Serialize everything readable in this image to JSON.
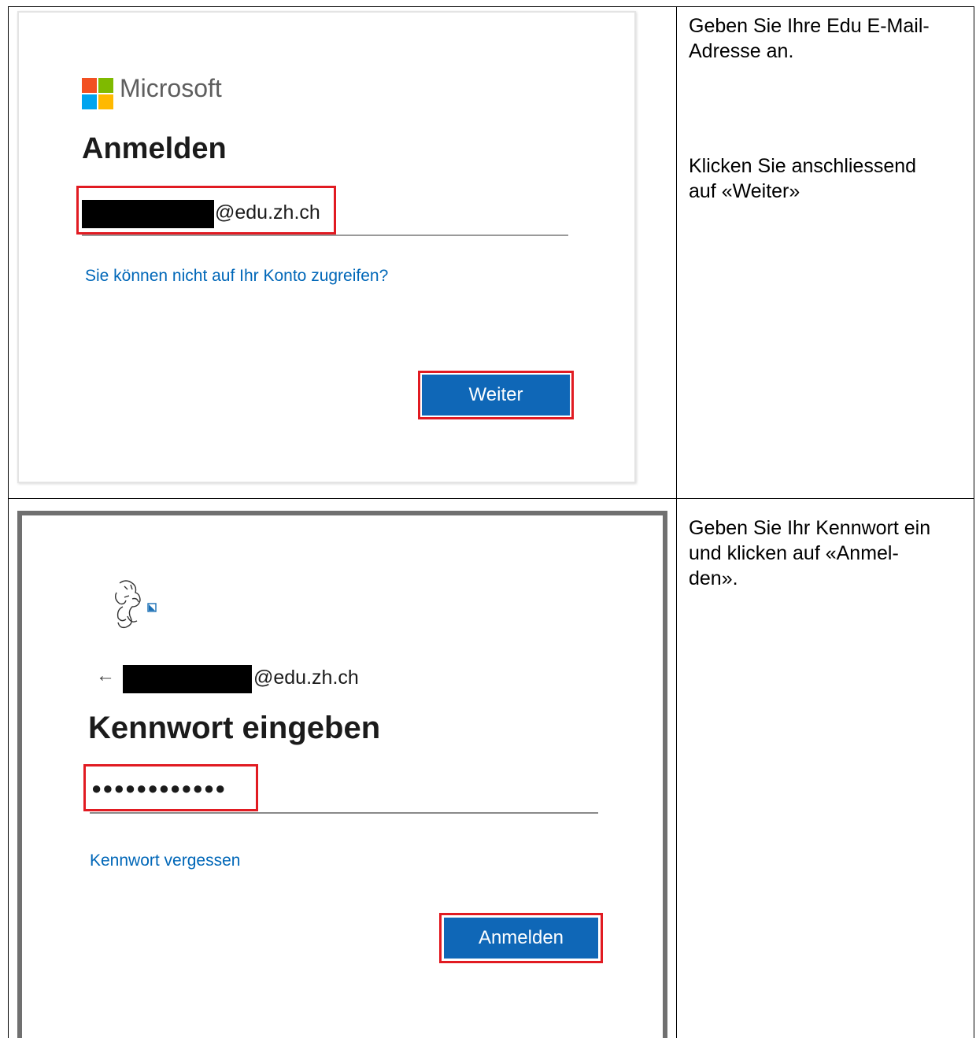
{
  "step1": {
    "instruction_line1": "Geben Sie Ihre Edu E-Mail-",
    "instruction_line2": "Adresse an.",
    "instruction2_line1": "Klicken Sie anschliessend",
    "instruction2_line2": "auf «Weiter»",
    "brand": "Microsoft",
    "title": "Anmelden",
    "email_suffix": "@edu.zh.ch",
    "link": "Sie können nicht auf Ihr Konto zugreifen?",
    "button": "Weiter",
    "colors": {
      "accent": "#0f67b7",
      "highlight": "#e11b22",
      "link": "#0067b8"
    }
  },
  "step2": {
    "instruction_line1": "Geben Sie Ihr Kennwort ein",
    "instruction_line2": "und klicken auf «Anmel-",
    "instruction_line3": "den».",
    "email_suffix": "@edu.zh.ch",
    "back_icon": "←",
    "title": "Kennwort eingeben",
    "password_mask": "●●●●●●●●●●●●",
    "link": "Kennwort vergessen",
    "button": "Anmelden"
  }
}
